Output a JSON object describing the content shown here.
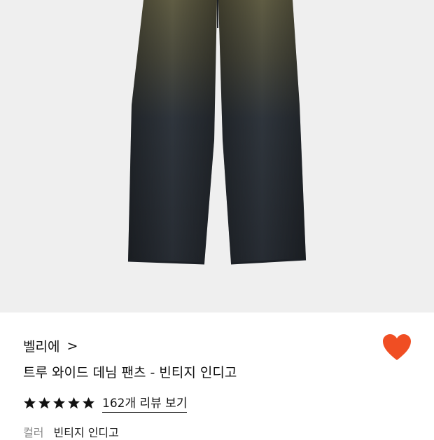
{
  "product": {
    "brand": "벨리에",
    "brand_chevron": ">",
    "title": "트루 와이드 데님 팬츠 - 빈티지 인디고",
    "rating_stars": 5,
    "reviews_link": "162개 리뷰 보기",
    "color_label": "컬러",
    "color_value": "빈티지 인디고"
  },
  "icons": {
    "favorite": "heart-icon",
    "star": "star-icon",
    "chevron": "chevron-right-icon"
  },
  "colors": {
    "accent": "#f04e23",
    "image_background": "#efefef",
    "denim_dark": "#2b313a",
    "denim_fade": "#6c6a4c"
  }
}
